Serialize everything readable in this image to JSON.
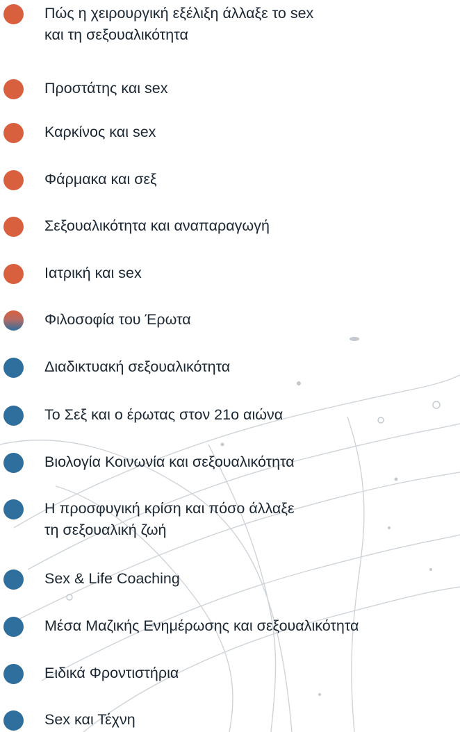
{
  "colors": {
    "bullet_orange": "#d9603e",
    "bullet_blue": "#2f6f9e",
    "text": "#1b2733",
    "decor_lines": "#c7ccd2"
  },
  "topics": [
    {
      "label": "Πώς η χειρουργική εξέλιξη άλλαξε το sex\nκαι τη σεξουαλικότητα",
      "bullet": "orange"
    },
    {
      "label": "Προστάτης και sex",
      "bullet": "orange"
    },
    {
      "label": "Καρκίνος και sex",
      "bullet": "orange"
    },
    {
      "label": "Φάρμακα και σεξ",
      "bullet": "orange"
    },
    {
      "label": "Σεξουαλικότητα και αναπαραγωγή",
      "bullet": "orange"
    },
    {
      "label": "Ιατρική και sex",
      "bullet": "orange"
    },
    {
      "label": "Φιλοσοφία του Έρωτα",
      "bullet": "orange-blue"
    },
    {
      "label": "Διαδικτυακή σεξουαλικότητα",
      "bullet": "blue"
    },
    {
      "label": "Το Σεξ και ο έρωτας στον 21ο αιώνα",
      "bullet": "blue"
    },
    {
      "label": "Βιολογία Κοινωνία και σεξουαλικότητα",
      "bullet": "blue"
    },
    {
      "label": "Η προσφυγική κρίση και πόσο άλλαξε\nτη σεξουαλική ζωή",
      "bullet": "blue"
    },
    {
      "label": "Sex & Life Coaching",
      "bullet": "blue"
    },
    {
      "label": "Μέσα Μαζικής Ενημέρωσης και σεξουαλικότητα",
      "bullet": "blue"
    },
    {
      "label": "Ειδικά Φροντιστήρια",
      "bullet": "blue"
    },
    {
      "label": "Sex και Τέχνη",
      "bullet": "blue"
    }
  ]
}
